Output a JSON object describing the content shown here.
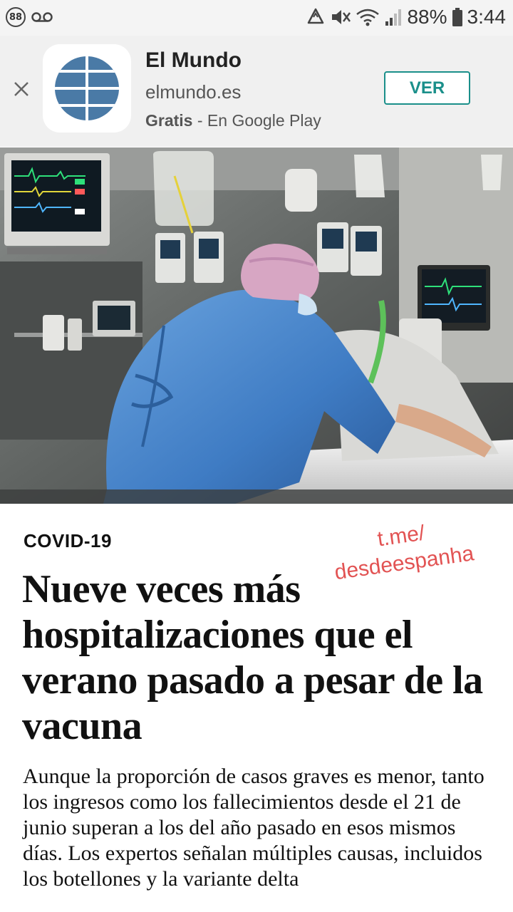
{
  "status_bar": {
    "notification_count": "88",
    "battery_percent": "88%",
    "time": "3:44"
  },
  "app_banner": {
    "app_name": "El Mundo",
    "domain": "elmundo.es",
    "price": "Gratis",
    "store_text": " - En Google Play",
    "cta_label": "VER",
    "accent_color": "#1a8f8a",
    "icon": "el-mundo-globe-icon"
  },
  "hero_image": {
    "subject": "photo-icu"
  },
  "article": {
    "section": "COVID-19",
    "headline": "Nueve veces más hospitalizaciones que el verano pasado a pesar de la vacuna",
    "lede": "Aunque la proporción de casos graves es menor, tanto los ingresos como los fallecimientos desde el 21 de junio superan a los del año pasado en esos mismos días. Los expertos señalan múltiples causas, incluidos los botellones y la variante delta"
  },
  "watermark": {
    "line1": "t.me/",
    "line2": "desdeespanha",
    "color": "#e25353"
  }
}
